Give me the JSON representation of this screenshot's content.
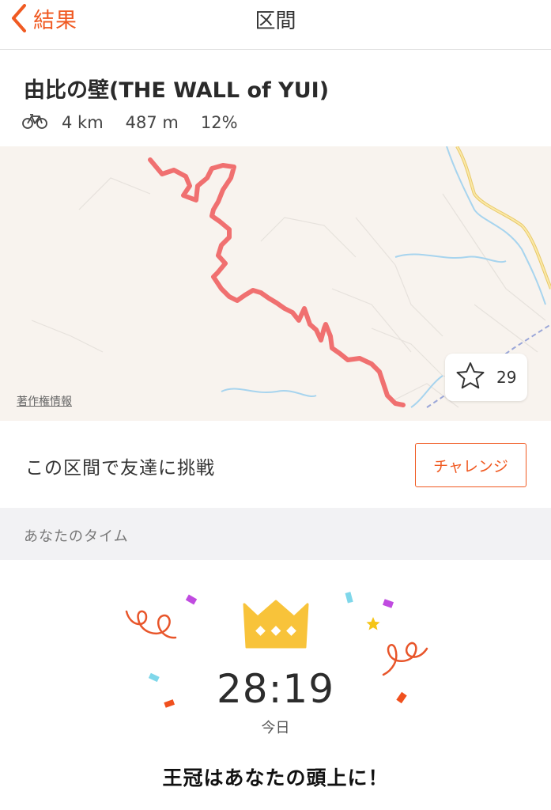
{
  "nav": {
    "back_label": "結果",
    "title": "区間",
    "back_icon": "chevron-left-icon",
    "accent_color": "#f05a22"
  },
  "segment": {
    "name": "由比の壁(THE WALL of YUI)",
    "activity_icon": "bicycle-icon",
    "distance": "4 km",
    "elevation": "487 m",
    "grade": "12%"
  },
  "map": {
    "attribution": "著作権情報",
    "route_color": "#f07070",
    "star_icon": "star-outline-icon",
    "star_count": "29"
  },
  "challenge": {
    "text": "この区間で友達に挑戦",
    "button_label": "チャレンジ"
  },
  "your_time": {
    "section_label": "あなたのタイム",
    "crown_icon": "crown-icon",
    "crown_color": "#f8c33a",
    "time": "28:19",
    "date": "今日",
    "message": "王冠はあなたの頭上に！"
  }
}
